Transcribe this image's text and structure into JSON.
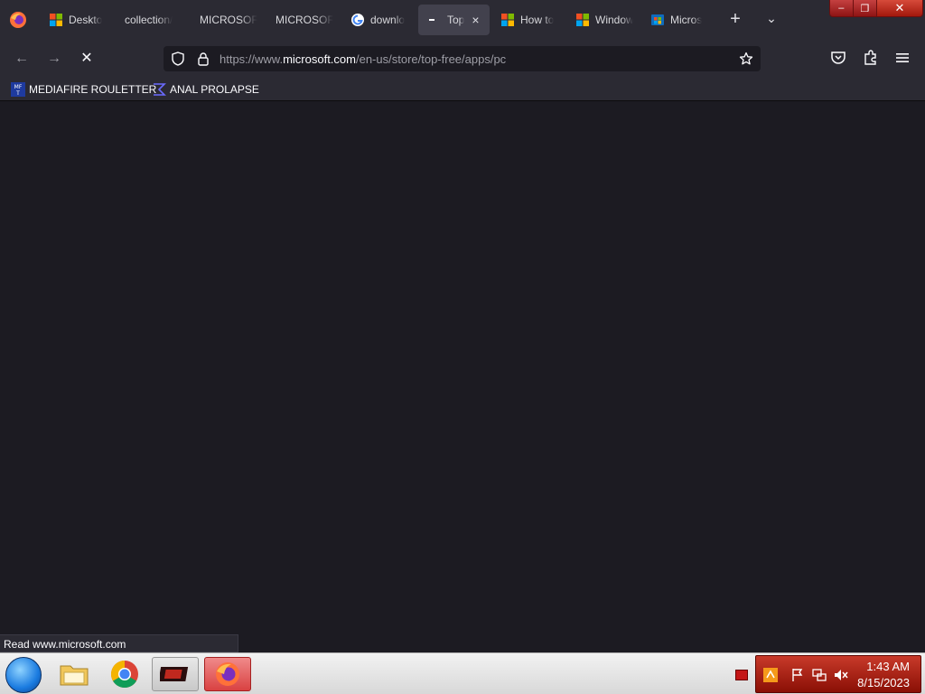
{
  "tabs": [
    {
      "title": "Deskto",
      "favicon": "microsoft-logo-icon",
      "active": false
    },
    {
      "title": "collection/",
      "favicon": "none",
      "active": false
    },
    {
      "title": "MICROSOF",
      "favicon": "none",
      "active": false
    },
    {
      "title": "MICROSOF",
      "favicon": "none",
      "active": false
    },
    {
      "title": "downlo",
      "favicon": "google-g-icon",
      "active": false
    },
    {
      "title": "Top",
      "favicon": "loading-dots-icon",
      "active": true,
      "close": "×"
    },
    {
      "title": "How to",
      "favicon": "microsoft-logo-icon",
      "active": false
    },
    {
      "title": "Window",
      "favicon": "microsoft-logo-icon",
      "active": false
    },
    {
      "title": "Micros",
      "favicon": "store-icon",
      "active": false
    }
  ],
  "tabstrip": {
    "new_tab": "+",
    "list_all": "⌄"
  },
  "window_controls": {
    "minimize": "–",
    "maximize": "❐",
    "close": "✕"
  },
  "navbar": {
    "back": "←",
    "forward": "→",
    "stop": "✕",
    "url_prefix": "https://www.",
    "url_domain": "microsoft.com",
    "url_path": "/en-us/store/top-free/apps/pc"
  },
  "bookmarks": [
    {
      "label": "MEDIAFIRE ROULETTER",
      "icon": "mediafire-icon"
    },
    {
      "label": "ANAL PROLAPSE",
      "icon": "sigma-icon"
    }
  ],
  "status_text": "Read www.microsoft.com",
  "taskbar": {
    "apps": [
      "start-orb",
      "file-explorer",
      "chrome",
      "media-app",
      "firefox"
    ],
    "active_app": "firefox"
  },
  "clock": {
    "time": "1:43 AM",
    "date": "8/15/2023"
  },
  "colors": {
    "toolbar": "#2b2a33",
    "content": "#1c1b22",
    "tray_accent": "#c83a2a"
  }
}
